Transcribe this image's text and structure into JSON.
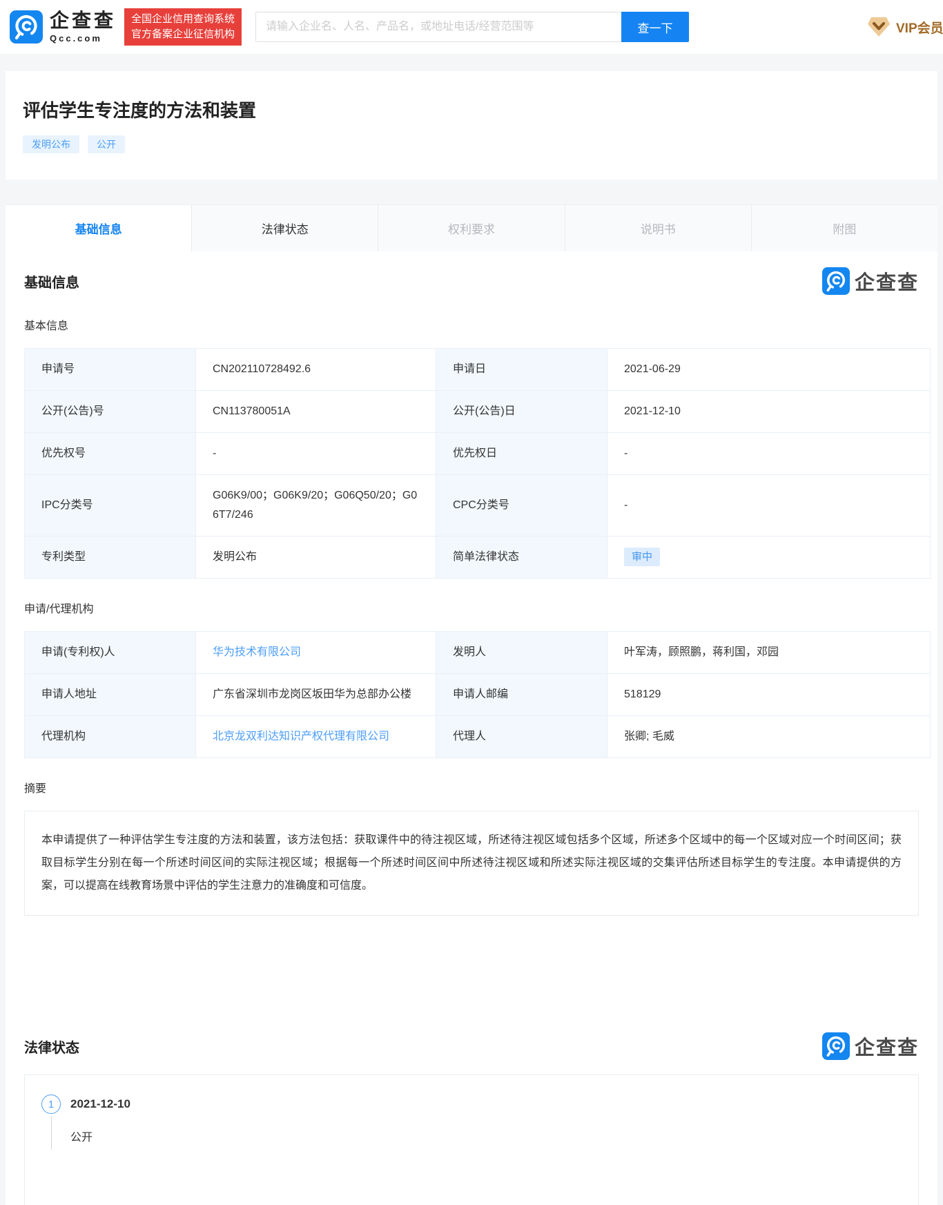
{
  "header": {
    "logo_text": "企查查",
    "logo_sub": "Qcc.com",
    "badge_line1": "全国企业信用查询系统",
    "badge_line2": "官方备案企业征信机构",
    "search_placeholder": "请输入企业名、人名、产品名，或地址电话/经营范围等",
    "search_button": "查一下",
    "vip_label": "VIP会员"
  },
  "patent": {
    "title": "评估学生专注度的方法和装置",
    "tags": [
      "发明公布",
      "公开"
    ]
  },
  "tabs": [
    {
      "label": "基础信息"
    },
    {
      "label": "法律状态"
    },
    {
      "label": "权利要求"
    },
    {
      "label": "说明书"
    },
    {
      "label": "附图"
    }
  ],
  "watermark": {
    "text": "企查查"
  },
  "basic_section": {
    "heading": "基础信息",
    "subheading": "基本信息",
    "rows": [
      {
        "label1": "申请号",
        "value1": "CN202110728492.6",
        "label2": "申请日",
        "value2": "2021-06-29"
      },
      {
        "label1": "公开(公告)号",
        "value1": "CN113780051A",
        "label2": "公开(公告)日",
        "value2": "2021-12-10"
      },
      {
        "label1": "优先权号",
        "value1": "-",
        "label2": "优先权日",
        "value2": "-"
      },
      {
        "label1": "IPC分类号",
        "value1": "G06K9/00；G06K9/20；G06Q50/20；G06T7/246",
        "label2": "CPC分类号",
        "value2": "-"
      },
      {
        "label1": "专利类型",
        "value1": "发明公布",
        "label2": "简单法律状态",
        "value2": "审中"
      }
    ]
  },
  "agency_section": {
    "subheading": "申请/代理机构",
    "rows": [
      {
        "label1": "申请(专利权)人",
        "value1": "华为技术有限公司",
        "label2": "发明人",
        "value2": "叶军涛，顾照鹏，蒋利国，邓园"
      },
      {
        "label1": "申请人地址",
        "value1": "广东省深圳市龙岗区坂田华为总部办公楼",
        "label2": "申请人邮编",
        "value2": "518129"
      },
      {
        "label1": "代理机构",
        "value1": "北京龙双利达知识产权代理有限公司",
        "label2": "代理人",
        "value2": "张卿; 毛威"
      }
    ]
  },
  "abstract_section": {
    "subheading": "摘要",
    "text": "本申请提供了一种评估学生专注度的方法和装置，该方法包括：获取课件中的待注视区域，所述待注视区域包括多个区域，所述多个区域中的每一个区域对应一个时间区间；获取目标学生分别在每一个所述时间区间的实际注视区域；根据每一个所述时间区间中所述待注视区域和所述实际注视区域的交集评估所述目标学生的专注度。本申请提供的方案，可以提高在线教育场景中评估的学生注意力的准确度和可信度。"
  },
  "legal_section": {
    "heading": "法律状态",
    "timeline": [
      {
        "index": "1",
        "date": "2021-12-10",
        "status": "公开"
      }
    ]
  },
  "colors": {
    "accent_blue": "#1584f2",
    "link_blue": "#4c9ef8",
    "badge_red": "#e7403b",
    "tag_bg": "#e8f3fe",
    "status_badge_bg": "#dcecfd",
    "label_cell_bg": "#f2f8fd",
    "vip_gold": "#a26b28"
  }
}
